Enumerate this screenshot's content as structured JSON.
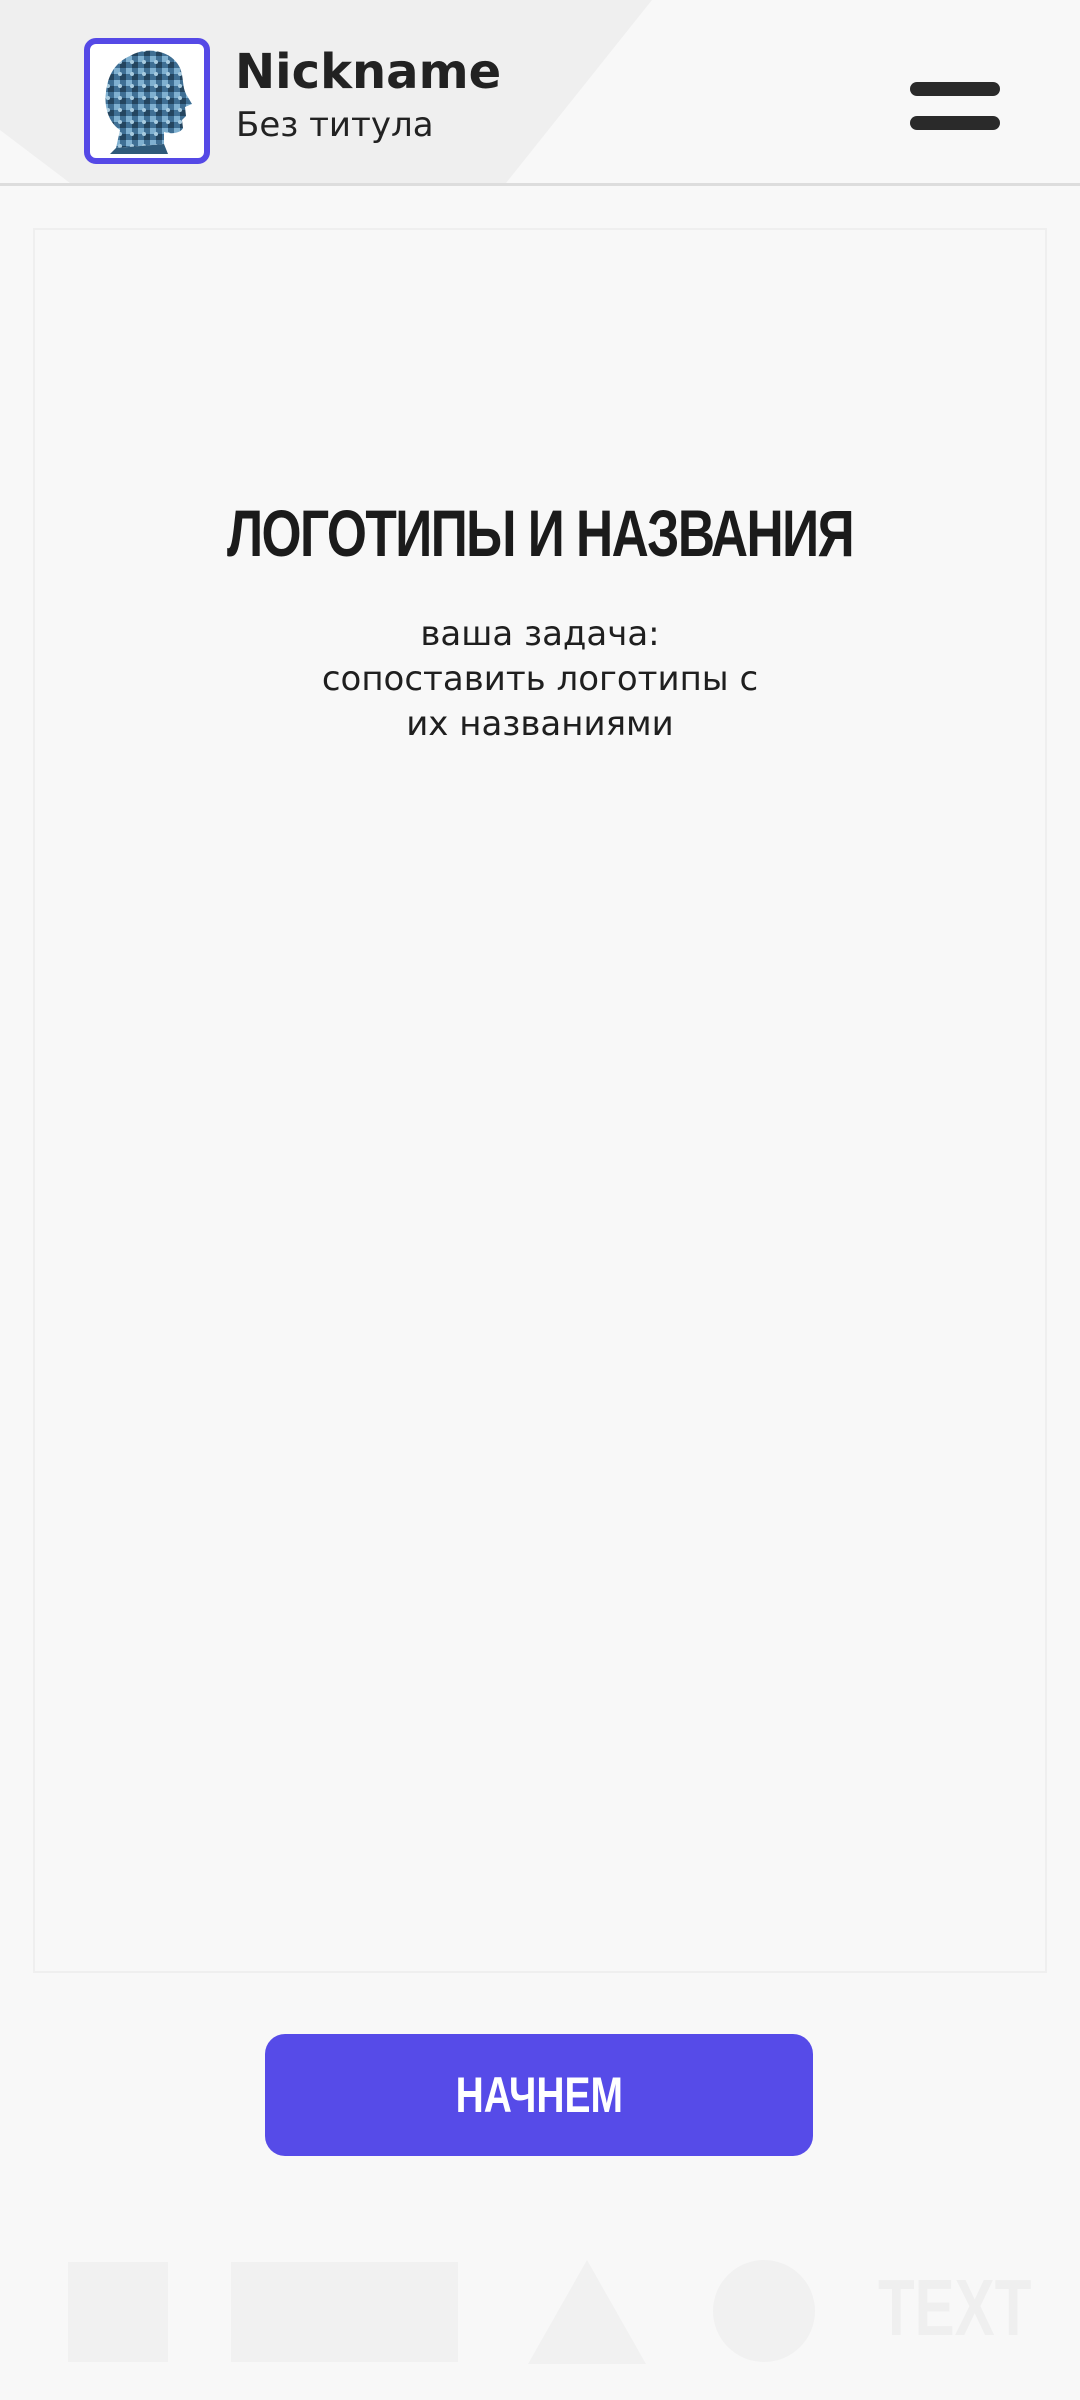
{
  "header": {
    "nickname": "Nickname",
    "user_title": "Без титула",
    "avatar_icon": "puzzle-head-avatar-icon",
    "menu_icon": "hamburger-menu-icon",
    "accent_color": "#5549e6"
  },
  "card": {
    "title": "ЛОГОТИПЫ И НАЗВАНИЯ",
    "description_line1": "ваша задача:",
    "description_line2": "сопоставить логотипы с",
    "description_line3": "их названиями"
  },
  "start_button": {
    "label": "НАЧНЕМ",
    "color": "#564be8"
  },
  "footer_decor": {
    "text": "TEXT",
    "shapes": [
      "square-shape",
      "rectangle-shape",
      "triangle-shape",
      "circle-shape"
    ]
  }
}
